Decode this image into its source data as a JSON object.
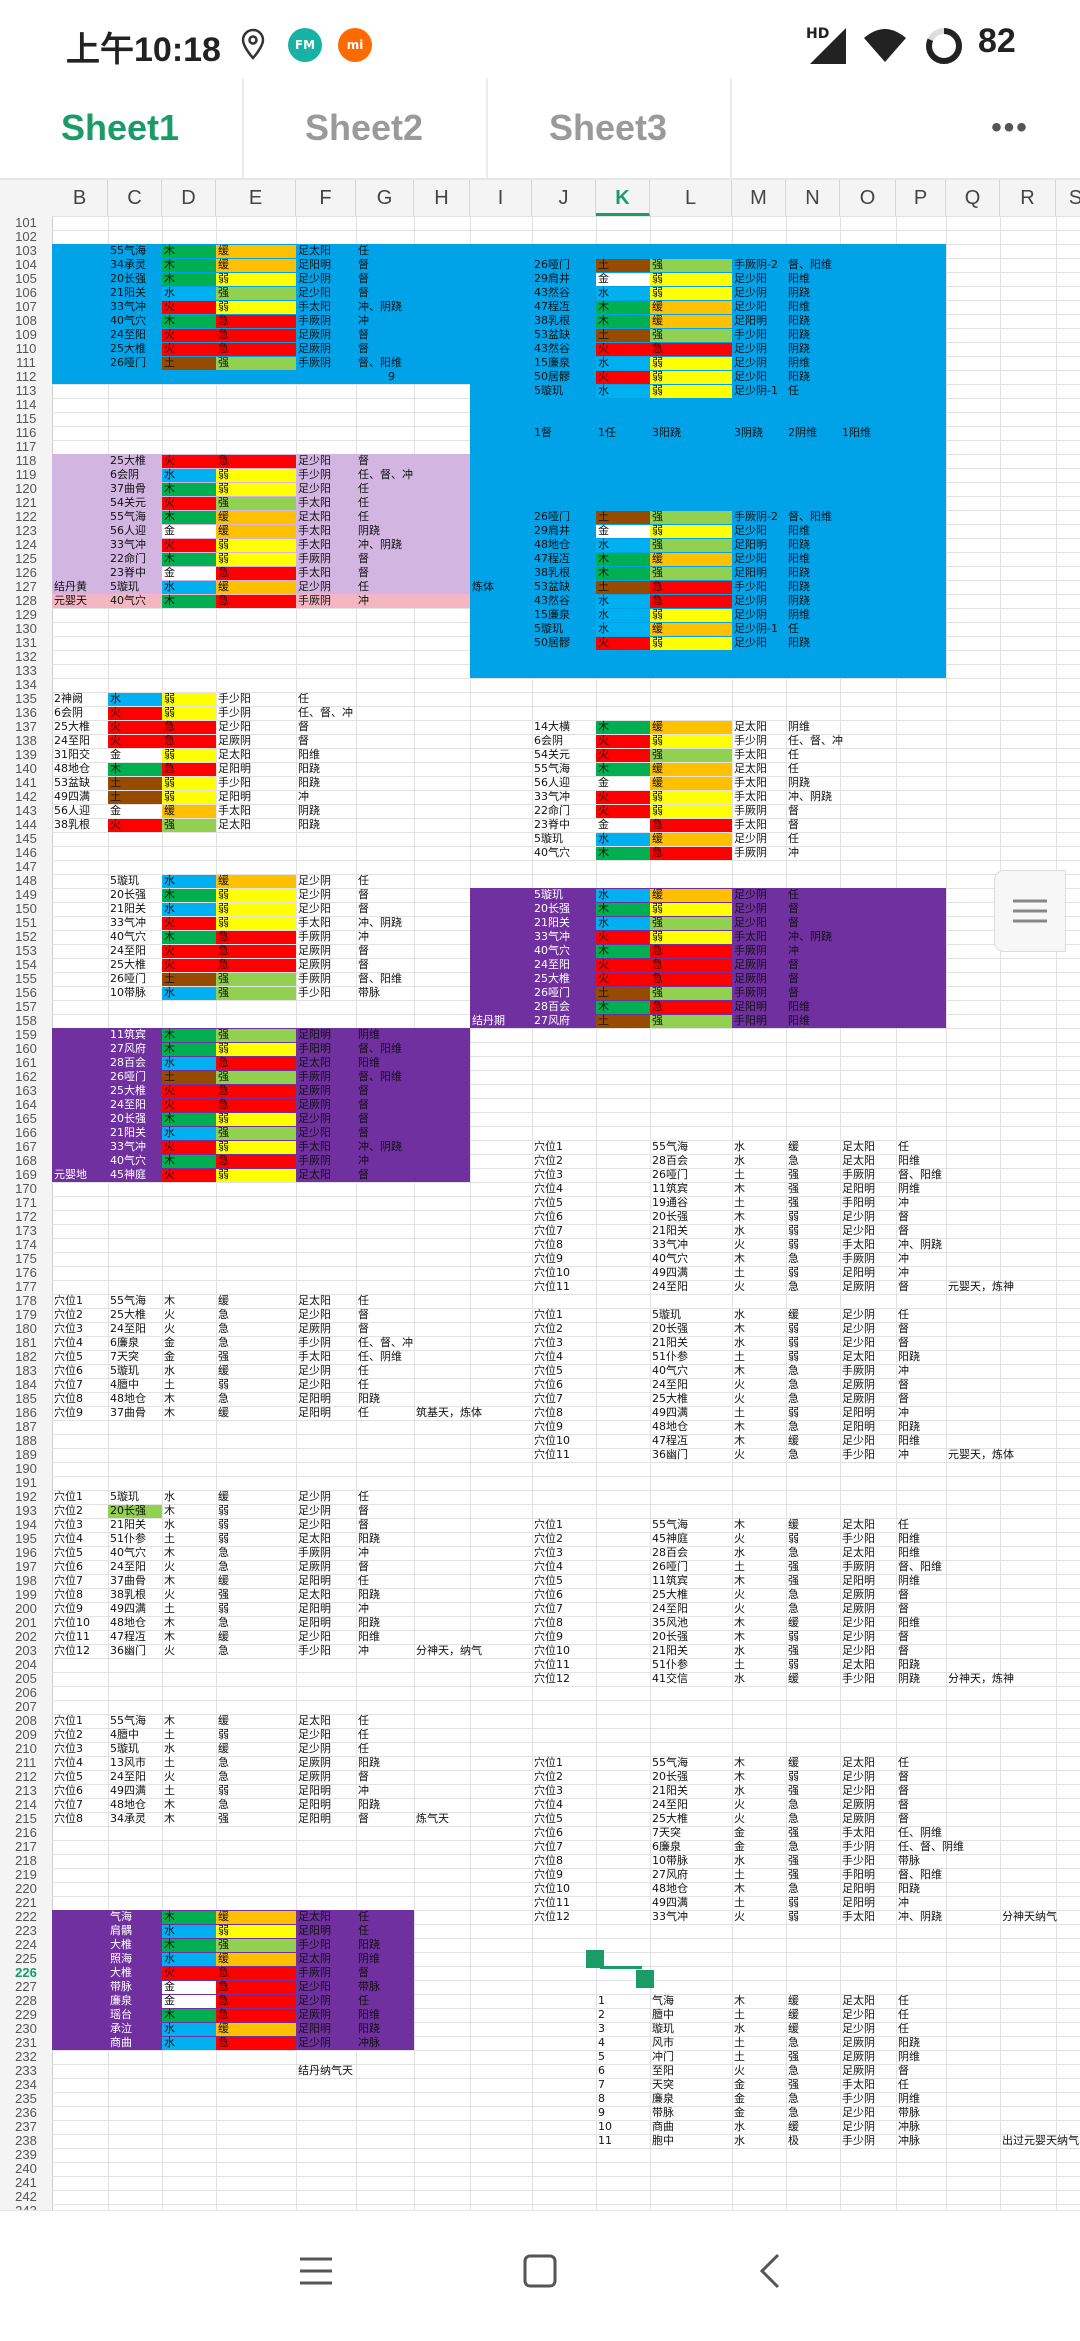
{
  "status": {
    "time": "上午10:18",
    "battery": "82",
    "net": "HD",
    "badge_fm": "FM",
    "badge_mi": "mi"
  },
  "tabs": [
    {
      "label": "Sheet1"
    },
    {
      "label": "Sheet2"
    },
    {
      "label": "Sheet3"
    }
  ],
  "more_label": "•••",
  "columns": [
    "B",
    "C",
    "D",
    "E",
    "F",
    "G",
    "H",
    "I",
    "J",
    "K",
    "L",
    "M",
    "N",
    "O",
    "P",
    "Q",
    "R",
    "S"
  ],
  "active_column": "K",
  "rows_first": 101,
  "rows_last": 244,
  "active_row": "226",
  "colors": {
    "accent": "#1a9b68",
    "blue_region": "#00a2e8",
    "purple_region": "#7030a0",
    "lavender_region": "#d2b5e0",
    "green": "#00b050",
    "red": "#ff0000",
    "yellow": "#ffff00",
    "orange": "#ffc000",
    "brown": "#964b00",
    "lightgreen": "#92d050",
    "skyblue": "#00b0f0",
    "pink": "#f4b6c2"
  },
  "annotations": {
    "n9": "9",
    "row114_j": "1督",
    "row114_k": "1任",
    "row114_l": "3阳跷",
    "row114_m": "3阴跷",
    "row114_n": "2阴维",
    "row114_o": "1阳维",
    "lianti": "炼体",
    "jiedan": "结丹黄",
    "yuanyingtian": "元婴天",
    "yuanying_di": "元婴地",
    "jiedan_ji": "结丹期",
    "zhuji": "筑基天，炼体",
    "fenshen": "分神天，纳气",
    "fenshen_k": "分神天，炼神",
    "yuanying_lianshen": "元婴天，炼神",
    "yuanying2": "元婴天，炼体",
    "lianqi": "炼气天",
    "fenshen2": "分神天纳气",
    "jiedan_naqi": "结丹纳气天",
    "chuguo": "出过元婴天纳气"
  },
  "block1": [
    {
      "c": "55气海",
      "d": "木",
      "e": "缓",
      "f": "足太阳",
      "g": "任"
    },
    {
      "c": "34承灵",
      "d": "木",
      "e": "缓",
      "f": "足阳明",
      "g": "督"
    },
    {
      "c": "20长强",
      "d": "木",
      "e": "弱",
      "f": "足少阴",
      "g": "督"
    },
    {
      "c": "21阳关",
      "d": "水",
      "e": "强",
      "f": "足少阳",
      "g": "督"
    },
    {
      "c": "33气冲",
      "d": "火",
      "e": "弱",
      "f": "手太阳",
      "g": "冲、阴跷"
    },
    {
      "c": "40气穴",
      "d": "木",
      "e": "急",
      "f": "手厥阴",
      "g": "冲"
    },
    {
      "c": "24至阳",
      "d": "火",
      "e": "急",
      "f": "足厥阴",
      "g": "督"
    },
    {
      "c": "25大椎",
      "d": "火",
      "e": "急",
      "f": "足厥阴",
      "g": "督"
    },
    {
      "c": "26哑门",
      "d": "土",
      "e": "强",
      "f": "手厥阴",
      "g": "督、阳维"
    }
  ],
  "block_k1": [
    {
      "j": "26哑门",
      "k": "土",
      "l": "强",
      "m": "手厥阴-2",
      "n": "督、阳维"
    },
    {
      "j": "29肩井",
      "k": "金",
      "l": "弱",
      "m": "足少阳",
      "n": "阳维"
    },
    {
      "j": "43然谷",
      "k": "水",
      "l": "弱",
      "m": "足少阴",
      "n": "阴跷"
    },
    {
      "j": "47程冱",
      "k": "木",
      "l": "缓",
      "m": "足少阳",
      "n": "阳维"
    },
    {
      "j": "38乳根",
      "k": "木",
      "l": "缓",
      "m": "足阳明",
      "n": "阳跷"
    },
    {
      "j": "53盆缺",
      "k": "土",
      "l": "强",
      "m": "手少阳",
      "n": "阳跷"
    },
    {
      "j": "43然谷",
      "k": "火",
      "l": "急",
      "m": "足少阴",
      "n": "阴跷"
    },
    {
      "j": "15廉泉",
      "k": "水",
      "l": "弱",
      "m": "足少阴",
      "n": "阴维"
    },
    {
      "j": "50居髎",
      "k": "火",
      "l": "弱",
      "m": "足少阳",
      "n": "阳跷"
    },
    {
      "j": "5璇玑",
      "k": "水",
      "l": "弱",
      "m": "足少阴-1",
      "n": "任"
    }
  ],
  "block2": [
    {
      "b": "",
      "c": "25大椎",
      "d": "火",
      "e": "急",
      "f": "足少阳",
      "g": "督"
    },
    {
      "b": "",
      "c": "6会阴",
      "d": "水",
      "e": "弱",
      "f": "手少阴",
      "g": "任、督、冲"
    },
    {
      "b": "",
      "c": "37曲骨",
      "d": "木",
      "e": "弱",
      "f": "足少阳",
      "g": "任"
    },
    {
      "b": "",
      "c": "54关元",
      "d": "火",
      "e": "强",
      "f": "手太阳",
      "g": "任"
    },
    {
      "b": "",
      "c": "55气海",
      "d": "木",
      "e": "缓",
      "f": "足太阳",
      "g": "任"
    },
    {
      "b": "",
      "c": "56人迎",
      "d": "金",
      "e": "缓",
      "f": "手太阳",
      "g": "阴跷"
    },
    {
      "b": "",
      "c": "33气冲",
      "d": "火",
      "e": "弱",
      "f": "手太阳",
      "g": "冲、阴跷"
    },
    {
      "b": "",
      "c": "22命门",
      "d": "木",
      "e": "弱",
      "f": "手厥阴",
      "g": "督"
    },
    {
      "b": "",
      "c": "23脊中",
      "d": "金",
      "e": "急",
      "f": "手太阳",
      "g": "督"
    },
    {
      "b": "结丹黄",
      "c": "5璇玑",
      "d": "水",
      "e": "缓",
      "f": "足少阴",
      "g": "任"
    },
    {
      "b": "元婴天",
      "c": "40气穴",
      "d": "木",
      "e": "急",
      "f": "手厥阴",
      "g": "冲"
    }
  ],
  "block_k2": [
    {
      "j": "26哑门",
      "k": "土",
      "l": "强",
      "m": "手厥阴-2",
      "n": "督、阳维"
    },
    {
      "j": "29肩井",
      "k": "金",
      "l": "弱",
      "m": "足少阳",
      "n": "阳维"
    },
    {
      "j": "48地仓",
      "k": "水",
      "l": "强",
      "m": "足阳明",
      "n": "阳跷"
    },
    {
      "j": "47程冱",
      "k": "木",
      "l": "缓",
      "m": "足少阳",
      "n": "阳维"
    },
    {
      "j": "38乳根",
      "k": "木",
      "l": "强",
      "m": "足阳明",
      "n": "阳跷"
    },
    {
      "j": "53盆缺",
      "k": "土",
      "l": "急",
      "m": "手少阳",
      "n": "阳跷"
    },
    {
      "j": "43然谷",
      "k": "水",
      "l": "急",
      "m": "足少阴",
      "n": "阴跷"
    },
    {
      "j": "15廉泉",
      "k": "水",
      "l": "弱",
      "m": "足少阴",
      "n": "阴维"
    },
    {
      "j": "5璇玑",
      "k": "水",
      "l": "缓",
      "m": "足少阴-1",
      "n": "任"
    },
    {
      "j": "50居髎",
      "k": "火",
      "l": "弱",
      "m": "足少阳",
      "n": "阳跷"
    }
  ],
  "block3": [
    {
      "b": "2神阙",
      "c": "水",
      "d": "弱",
      "e": "手少阳",
      "f": "任"
    },
    {
      "b": "6会阴",
      "c": "火",
      "d": "弱",
      "e": "手少阴",
      "f": "任、督、冲"
    },
    {
      "b": "25大椎",
      "c": "火",
      "d": "急",
      "e": "足少阳",
      "f": "督"
    },
    {
      "b": "24至阳",
      "c": "火",
      "d": "急",
      "e": "足厥阴",
      "f": "督"
    },
    {
      "b": "31阳交",
      "c": "金",
      "d": "弱",
      "e": "足太阳",
      "f": "阳维"
    },
    {
      "b": "48地仓",
      "c": "木",
      "d": "急",
      "e": "足阳明",
      "f": "阳跷"
    },
    {
      "b": "53盆缺",
      "c": "土",
      "d": "弱",
      "e": "手少阳",
      "f": "阳跷"
    },
    {
      "b": "49四满",
      "c": "土",
      "d": "弱",
      "e": "足阳明",
      "f": "冲"
    },
    {
      "b": "56人迎",
      "c": "金",
      "d": "缓",
      "e": "手太阳",
      "f": "阴跷"
    },
    {
      "b": "38乳根",
      "c": "火",
      "d": "强",
      "e": "足太阳",
      "f": "阳跷"
    }
  ],
  "block_k3": [
    {
      "j": "14大横",
      "k": "木",
      "l": "缓",
      "m": "足太阳",
      "n": "阴维"
    },
    {
      "j": "6会阴",
      "k": "火",
      "l": "弱",
      "m": "手少阴",
      "n": "任、督、冲"
    },
    {
      "j": "54关元",
      "k": "火",
      "l": "强",
      "m": "手太阳",
      "n": "任"
    },
    {
      "j": "55气海",
      "k": "木",
      "l": "缓",
      "m": "足太阳",
      "n": "任"
    },
    {
      "j": "56人迎",
      "k": "金",
      "l": "缓",
      "m": "手太阳",
      "n": "阴跷"
    },
    {
      "j": "33气冲",
      "k": "火",
      "l": "弱",
      "m": "手太阳",
      "n": "冲、阴跷"
    },
    {
      "j": "22命门",
      "k": "火",
      "l": "弱",
      "m": "手厥阴",
      "n": "督"
    },
    {
      "j": "23脊中",
      "k": "金",
      "l": "急",
      "m": "手太阳",
      "n": "督"
    },
    {
      "j": "5璇玑",
      "k": "水",
      "l": "缓",
      "m": "足少阴",
      "n": "任"
    },
    {
      "j": "40气穴",
      "k": "木",
      "l": "急",
      "m": "手厥阴",
      "n": "冲"
    }
  ],
  "block4": [
    {
      "c": "5璇玑",
      "d": "水",
      "e": "缓",
      "f": "足少阴",
      "g": "任"
    },
    {
      "c": "20长强",
      "d": "木",
      "e": "弱",
      "f": "足少阴",
      "g": "督"
    },
    {
      "c": "21阳关",
      "d": "水",
      "e": "弱",
      "f": "足少阳",
      "g": "督"
    },
    {
      "c": "33气冲",
      "d": "火",
      "e": "弱",
      "f": "手太阳",
      "g": "冲、阴跷"
    },
    {
      "c": "40气穴",
      "d": "木",
      "e": "急",
      "f": "手厥阴",
      "g": "冲"
    },
    {
      "c": "24至阳",
      "d": "火",
      "e": "急",
      "f": "足厥阴",
      "g": "督"
    },
    {
      "c": "25大椎",
      "d": "火",
      "e": "急",
      "f": "足厥阴",
      "g": "督"
    },
    {
      "c": "26哑门",
      "d": "土",
      "e": "强",
      "f": "手厥阴",
      "g": "督、阳维"
    },
    {
      "c": "10带脉",
      "d": "水",
      "e": "强",
      "f": "手少阳",
      "g": "带脉"
    }
  ],
  "block_k4": [
    {
      "j": "5璇玑",
      "k": "水",
      "l": "缓",
      "m": "足少阴",
      "n": "任"
    },
    {
      "j": "20长强",
      "k": "木",
      "l": "弱",
      "m": "足少阴",
      "n": "督"
    },
    {
      "j": "21阳关",
      "k": "水",
      "l": "强",
      "m": "足少阳",
      "n": "督"
    },
    {
      "j": "33气冲",
      "k": "火",
      "l": "弱",
      "m": "手太阳",
      "n": "冲、阴跷"
    },
    {
      "j": "40气穴",
      "k": "木",
      "l": "急",
      "m": "手厥阴",
      "n": "冲"
    },
    {
      "j": "24至阳",
      "k": "火",
      "l": "急",
      "m": "足厥阴",
      "n": "督"
    },
    {
      "j": "25大椎",
      "k": "火",
      "l": "急",
      "m": "足厥阴",
      "n": "督"
    },
    {
      "j": "26哑门",
      "k": "土",
      "l": "强",
      "m": "手厥阴",
      "n": "督"
    },
    {
      "j": "28百会",
      "k": "木",
      "l": "急",
      "m": "足阳明",
      "n": "阳维"
    },
    {
      "j": "27风府",
      "k": "土",
      "l": "强",
      "m": "手阳明",
      "n": "阳维"
    }
  ],
  "block5": [
    {
      "c": "11筑宾",
      "d": "木",
      "e": "强",
      "f": "足阳明",
      "g": "阴维"
    },
    {
      "c": "27风府",
      "d": "木",
      "e": "弱",
      "f": "手阳明",
      "g": "督、阳维"
    },
    {
      "c": "28百会",
      "d": "水",
      "e": "急",
      "f": "足太阳",
      "g": "阳维"
    },
    {
      "c": "26哑门",
      "d": "土",
      "e": "强",
      "f": "手厥阴",
      "g": "督、阳维"
    },
    {
      "c": "25大椎",
      "d": "火",
      "e": "急",
      "f": "足厥阴",
      "g": "督"
    },
    {
      "c": "24至阳",
      "d": "火",
      "e": "急",
      "f": "足厥阴",
      "g": "督"
    },
    {
      "c": "20长强",
      "d": "木",
      "e": "弱",
      "f": "足少阴",
      "g": "督"
    },
    {
      "c": "21阳关",
      "d": "水",
      "e": "强",
      "f": "足少阳",
      "g": "督"
    },
    {
      "c": "33气冲",
      "d": "火",
      "e": "弱",
      "f": "手太阳",
      "g": "冲、阴跷"
    },
    {
      "c": "40气穴",
      "d": "木",
      "e": "急",
      "f": "手厥阴",
      "g": "冲"
    },
    {
      "c": "45神庭",
      "d": "火",
      "e": "弱",
      "f": "足太阳",
      "g": "督"
    }
  ],
  "list_k1": [
    [
      "穴位1",
      "55气海",
      "水",
      "缓",
      "足太阳",
      "任"
    ],
    [
      "穴位2",
      "28百会",
      "水",
      "急",
      "足太阳",
      "阳维"
    ],
    [
      "穴位3",
      "26哑门",
      "土",
      "强",
      "手厥阴",
      "督、阳维"
    ],
    [
      "穴位4",
      "11筑宾",
      "木",
      "强",
      "足阳明",
      "阴维"
    ],
    [
      "穴位5",
      "19通谷",
      "土",
      "强",
      "手阳明",
      "冲"
    ],
    [
      "穴位6",
      "20长强",
      "木",
      "弱",
      "足少阴",
      "督"
    ],
    [
      "穴位7",
      "21阳关",
      "水",
      "弱",
      "足少阳",
      "督"
    ],
    [
      "穴位8",
      "33气冲",
      "火",
      "弱",
      "手太阳",
      "冲、阴跷"
    ],
    [
      "穴位9",
      "40气穴",
      "木",
      "急",
      "手厥阴",
      "冲"
    ],
    [
      "穴位10",
      "49四满",
      "土",
      "弱",
      "足阳明",
      "冲"
    ],
    [
      "穴位11",
      "24至阳",
      "火",
      "急",
      "足厥阴",
      "督"
    ]
  ],
  "list_c1": [
    [
      "穴位1",
      "55气海",
      "木",
      "缓",
      "足太阳",
      "任"
    ],
    [
      "穴位2",
      "25大椎",
      "火",
      "急",
      "足少阳",
      "督"
    ],
    [
      "穴位3",
      "24至阳",
      "火",
      "急",
      "足厥阴",
      "督"
    ],
    [
      "穴位4",
      "6廉泉",
      "金",
      "急",
      "手少阴",
      "任、督、冲"
    ],
    [
      "穴位5",
      "7天突",
      "金",
      "强",
      "手太阳",
      "任、阴维"
    ],
    [
      "穴位6",
      "5璇玑",
      "水",
      "缓",
      "足少阴",
      "任"
    ],
    [
      "穴位7",
      "4膻中",
      "土",
      "弱",
      "足少阳",
      "任"
    ],
    [
      "穴位8",
      "48地仓",
      "木",
      "急",
      "足阳明",
      "阳跷"
    ],
    [
      "穴位9",
      "37曲骨",
      "木",
      "缓",
      "足阳明",
      "任"
    ]
  ],
  "list_k2": [
    [
      "穴位1",
      "5璇玑",
      "水",
      "缓",
      "足少阴",
      "任"
    ],
    [
      "穴位2",
      "20长强",
      "木",
      "弱",
      "足少阴",
      "督"
    ],
    [
      "穴位3",
      "21阳关",
      "水",
      "弱",
      "足少阳",
      "督"
    ],
    [
      "穴位4",
      "51仆参",
      "土",
      "弱",
      "足太阳",
      "阳跷"
    ],
    [
      "穴位5",
      "40气穴",
      "木",
      "急",
      "手厥阴",
      "冲"
    ],
    [
      "穴位6",
      "24至阳",
      "火",
      "急",
      "足厥阴",
      "督"
    ],
    [
      "穴位7",
      "25大椎",
      "火",
      "急",
      "足厥阴",
      "督"
    ],
    [
      "穴位8",
      "49四满",
      "土",
      "弱",
      "足阳明",
      "冲"
    ],
    [
      "穴位9",
      "48地仓",
      "木",
      "急",
      "足阳明",
      "阳跷"
    ],
    [
      "穴位10",
      "47程冱",
      "木",
      "缓",
      "足少阳",
      "阳维"
    ],
    [
      "穴位11",
      "36幽门",
      "火",
      "急",
      "手少阳",
      "冲"
    ]
  ],
  "list_c2": [
    [
      "穴位1",
      "5璇玑",
      "水",
      "缓",
      "足少阴",
      "任"
    ],
    [
      "穴位2",
      "20长强",
      "木",
      "弱",
      "足少阴",
      "督"
    ],
    [
      "穴位3",
      "21阳关",
      "水",
      "弱",
      "足少阳",
      "督"
    ],
    [
      "穴位4",
      "51仆参",
      "土",
      "弱",
      "足太阳",
      "阳跷"
    ],
    [
      "穴位5",
      "40气穴",
      "木",
      "急",
      "手厥阴",
      "冲"
    ],
    [
      "穴位6",
      "24至阳",
      "火",
      "急",
      "足厥阴",
      "督"
    ],
    [
      "穴位7",
      "37曲骨",
      "木",
      "缓",
      "足阳明",
      "任"
    ],
    [
      "穴位8",
      "38乳根",
      "火",
      "强",
      "足太阳",
      "阳跷"
    ],
    [
      "穴位9",
      "49四满",
      "土",
      "弱",
      "足阳明",
      "冲"
    ],
    [
      "穴位10",
      "48地仓",
      "木",
      "急",
      "足阳明",
      "阳跷"
    ],
    [
      "穴位11",
      "47程冱",
      "木",
      "缓",
      "足少阳",
      "阳维"
    ],
    [
      "穴位12",
      "36幽门",
      "火",
      "急",
      "手少阳",
      "冲"
    ]
  ],
  "list_k3": [
    [
      "穴位1",
      "55气海",
      "木",
      "缓",
      "足太阳",
      "任"
    ],
    [
      "穴位2",
      "45神庭",
      "火",
      "弱",
      "手少阳",
      "阳维"
    ],
    [
      "穴位3",
      "28百会",
      "水",
      "急",
      "足太阳",
      "阳维"
    ],
    [
      "穴位4",
      "26哑门",
      "土",
      "强",
      "手厥阴",
      "督、阳维"
    ],
    [
      "穴位5",
      "11筑宾",
      "木",
      "强",
      "足阳明",
      "阴维"
    ],
    [
      "穴位6",
      "25大椎",
      "火",
      "急",
      "足厥阴",
      "督"
    ],
    [
      "穴位7",
      "24至阳",
      "火",
      "急",
      "足厥阴",
      "督"
    ],
    [
      "穴位8",
      "35风池",
      "木",
      "缓",
      "足少阳",
      "阳维"
    ],
    [
      "穴位9",
      "20长强",
      "木",
      "弱",
      "足少阴",
      "督"
    ],
    [
      "穴位10",
      "21阳关",
      "水",
      "强",
      "足少阳",
      "督"
    ],
    [
      "穴位11",
      "51仆参",
      "土",
      "弱",
      "足太阳",
      "阳跷"
    ],
    [
      "穴位12",
      "41交信",
      "水",
      "缓",
      "手少阳",
      "阴跷"
    ]
  ],
  "list_c3": [
    [
      "穴位1",
      "55气海",
      "木",
      "缓",
      "足太阳",
      "任"
    ],
    [
      "穴位2",
      "4膻中",
      "土",
      "弱",
      "足少阳",
      "任"
    ],
    [
      "穴位3",
      "5璇玑",
      "水",
      "缓",
      "足少阴",
      "任"
    ],
    [
      "穴位4",
      "13风市",
      "土",
      "急",
      "足厥阴",
      "阳跷"
    ],
    [
      "穴位5",
      "24至阳",
      "火",
      "急",
      "足厥阴",
      "督"
    ],
    [
      "穴位6",
      "49四满",
      "土",
      "弱",
      "足阳明",
      "冲"
    ],
    [
      "穴位7",
      "48地仓",
      "木",
      "急",
      "足阳明",
      "阳跷"
    ],
    [
      "穴位8",
      "34承灵",
      "木",
      "强",
      "足阳明",
      "督"
    ]
  ],
  "list_k4": [
    [
      "穴位1",
      "55气海",
      "木",
      "缓",
      "足太阳",
      "任"
    ],
    [
      "穴位2",
      "20长强",
      "木",
      "弱",
      "足少阴",
      "督"
    ],
    [
      "穴位3",
      "21阳关",
      "水",
      "强",
      "足少阳",
      "督"
    ],
    [
      "穴位4",
      "24至阳",
      "火",
      "急",
      "足厥阴",
      "督"
    ],
    [
      "穴位5",
      "25大椎",
      "火",
      "急",
      "足厥阴",
      "督"
    ],
    [
      "穴位6",
      "7天突",
      "金",
      "强",
      "手太阳",
      "任、阴维"
    ],
    [
      "穴位7",
      "6廉泉",
      "金",
      "急",
      "手少阴",
      "任、督、阴维"
    ],
    [
      "穴位8",
      "10带脉",
      "水",
      "强",
      "手少阳",
      "带脉"
    ],
    [
      "穴位9",
      "27风府",
      "土",
      "强",
      "手阳明",
      "督、阳维"
    ],
    [
      "穴位10",
      "48地仓",
      "木",
      "急",
      "足阳明",
      "阳跷"
    ],
    [
      "穴位11",
      "49四满",
      "土",
      "弱",
      "足阳明",
      "冲"
    ],
    [
      "穴位12",
      "33气冲",
      "火",
      "弱",
      "手太阳",
      "冲、阴跷"
    ]
  ],
  "block6": [
    {
      "c": "气海",
      "d": "木",
      "e": "缓",
      "f": "足太阳",
      "g": "任"
    },
    {
      "c": "肩髃",
      "d": "水",
      "e": "弱",
      "f": "足阳明",
      "g": "任"
    },
    {
      "c": "大椎",
      "d": "木",
      "e": "强",
      "f": "手少阳",
      "g": "阳跷"
    },
    {
      "c": "照海",
      "d": "水",
      "e": "缓",
      "f": "足太阴",
      "g": "阴维"
    },
    {
      "c": "大椎",
      "d": "火",
      "e": "急",
      "f": "手厥阴",
      "g": "督"
    },
    {
      "c": "带脉",
      "d": "金",
      "e": "急",
      "f": "足少阳",
      "g": "带脉"
    },
    {
      "c": "廉泉",
      "d": "金",
      "e": "急",
      "f": "足少阴",
      "g": "任"
    },
    {
      "c": "瑶台",
      "d": "木",
      "e": "急",
      "f": "足厥阴",
      "g": "阳维"
    },
    {
      "c": "承泣",
      "d": "水",
      "e": "缓",
      "f": "足阳明",
      "g": "阳跷"
    },
    {
      "c": "商曲",
      "d": "水",
      "e": "急",
      "f": "足少阴",
      "g": "冲脉"
    }
  ],
  "list_k5": [
    [
      "1",
      "气海",
      "木",
      "缓",
      "足太阳",
      "任"
    ],
    [
      "2",
      "膻中",
      "土",
      "缓",
      "足少阳",
      "任"
    ],
    [
      "3",
      "璇玑",
      "水",
      "缓",
      "足少阴",
      "任"
    ],
    [
      "4",
      "风市",
      "土",
      "急",
      "足厥阴",
      "阳跷"
    ],
    [
      "5",
      "冲门",
      "土",
      "强",
      "足厥阴",
      "阴维"
    ],
    [
      "6",
      "至阳",
      "火",
      "急",
      "足厥阴",
      "督"
    ],
    [
      "7",
      "天突",
      "金",
      "强",
      "手太阳",
      "任"
    ],
    [
      "8",
      "廉泉",
      "金",
      "急",
      "手少阴",
      "阴维"
    ],
    [
      "9",
      "带脉",
      "金",
      "急",
      "足少阳",
      "带脉"
    ],
    [
      "10",
      "商曲",
      "水",
      "缓",
      "足少阴",
      "冲脉"
    ],
    [
      "11",
      "胞中",
      "水",
      "极",
      "手少阴",
      "冲脉"
    ]
  ],
  "footer_label": "结丹纳气天"
}
